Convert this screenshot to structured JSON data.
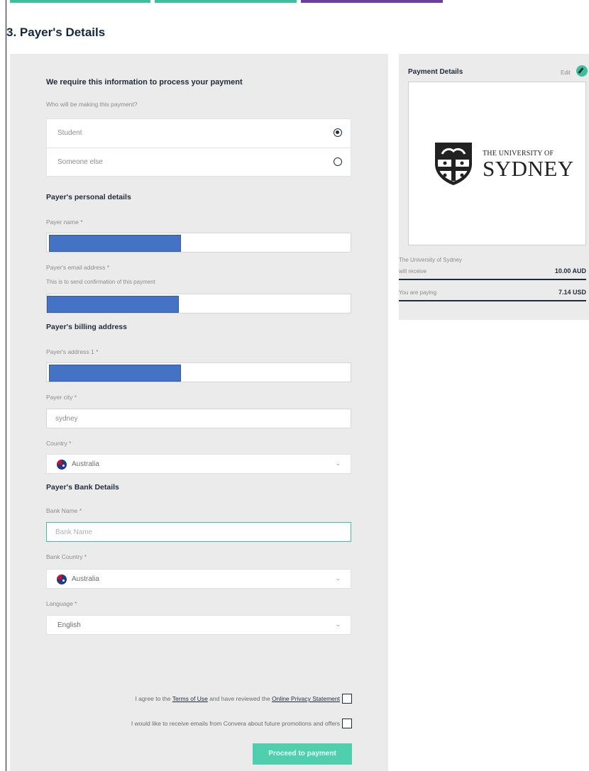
{
  "page": {
    "title": "3. Payer's Details"
  },
  "form": {
    "intro": "We require this information to process your payment",
    "question": "Who will be making this payment?",
    "payer_options": [
      {
        "label": "Student",
        "selected": true
      },
      {
        "label": "Someone else",
        "selected": false
      }
    ],
    "personal_heading": "Payer's personal details",
    "payer_name_label": "Payer name *",
    "email_label": "Payer's email address *",
    "email_hint": "This is to send confirmation of this payment",
    "billing_heading": "Payer's billing address",
    "address_label": "Payer's address 1 *",
    "city_label": "Payer city *",
    "city_value": "sydney",
    "country_label": "Country *",
    "country_value": "Australia",
    "bank_heading": "Payer's Bank Details",
    "bank_name_label": "Bank Name *",
    "bank_name_placeholder": "Bank Name",
    "bank_country_label": "Bank Country *",
    "bank_country_value": "Australia",
    "language_label": "Language *",
    "language_value": "English",
    "agree_prefix": "I agree to the ",
    "terms_link": "Terms of Use",
    "agree_middle": " and have reviewed the ",
    "privacy_link": "Online Privacy Statement",
    "promo_text": "I would like to receive emails from Convera about future promotions and offers",
    "proceed_label": "Proceed to payment"
  },
  "summary": {
    "title": "Payment Details",
    "edit": "Edit",
    "logo_line1": "THE UNIVERSITY OF",
    "logo_line2": "SYDNEY",
    "receiver_line1": "The University of Sydney",
    "receiver_line2": "will receive",
    "receive_amount": "10.00 AUD",
    "paying_label": "You are paying",
    "paying_amount": "7.14 USD"
  },
  "colors": {
    "accent": "#3fbf9c",
    "step_active": "#6b3fa0",
    "redaction": "#4472c4",
    "panel_bg": "#ebebeb"
  }
}
